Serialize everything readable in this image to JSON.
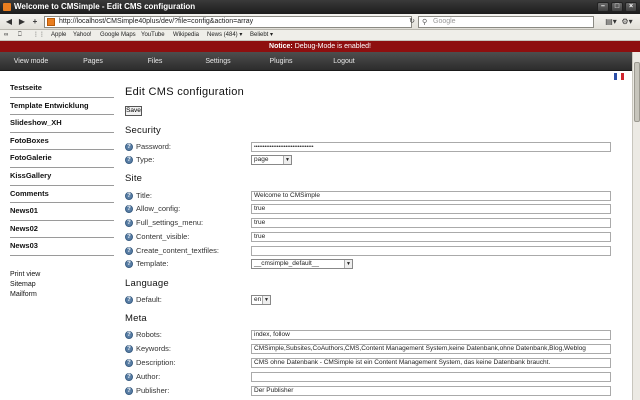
{
  "window": {
    "title": "Welcome to CMSimple - Edit CMS configuration"
  },
  "browser": {
    "url": "http://localhost/CMSimple40plus/dev/?file=config&action=array",
    "search_placeholder": "Google",
    "bookmarks": [
      "Apple",
      "Yahoo!",
      "Google Maps",
      "YouTube",
      "Wikipedia",
      "News (484) ▾",
      "Beliebt ▾"
    ]
  },
  "notice": {
    "label": "Notice:",
    "text": " Debug-Mode is enabled!"
  },
  "menu": [
    "View mode",
    "Pages",
    "Files",
    "Settings",
    "Plugins",
    "Logout"
  ],
  "sidebar": {
    "items": [
      "Testseite",
      "Template Entwicklung",
      "Slideshow_XH",
      "FotoBoxes",
      "FotoGalerie",
      "KissGallery",
      "Comments",
      "News01",
      "News02",
      "News03"
    ],
    "links": [
      "Print view",
      "Sitemap",
      "Mailform"
    ]
  },
  "page": {
    "title": "Edit CMS configuration",
    "save_label": "Save"
  },
  "sections": {
    "security": "Security",
    "site": "Site",
    "language": "Language",
    "meta": "Meta"
  },
  "fields": {
    "password": {
      "label": "Password:",
      "value": "••••••••••••••••••••••••••••••••••"
    },
    "type": {
      "label": "Type:",
      "value": "page"
    },
    "title": {
      "label": "Title:",
      "value": "Welcome to CMSimple"
    },
    "allow_config": {
      "label": "Allow_config:",
      "value": "true"
    },
    "full_settings_menu": {
      "label": "Full_settings_menu:",
      "value": "true"
    },
    "content_visible": {
      "label": "Content_visible:",
      "value": "true"
    },
    "create_content_textfiles": {
      "label": "Create_content_textfiles:",
      "value": ""
    },
    "template": {
      "label": "Template:",
      "value": "__cmsimple_default__"
    },
    "default": {
      "label": "Default:",
      "value": "en"
    },
    "robots": {
      "label": "Robots:",
      "value": "index, follow"
    },
    "keywords": {
      "label": "Keywords:",
      "value": "CMSimple,Subsites,CoAuthors,CMS,Content Management System,keine Datenbank,ohne Datenbank,Blog,Weblog"
    },
    "description": {
      "label": "Description:",
      "value": "CMS ohne Datenbank - CMSimple ist ein Content Management System, das keine Datenbank braucht."
    },
    "author": {
      "label": "Author:",
      "value": ""
    },
    "publisher": {
      "label": "Publisher:",
      "value": "Der Publisher"
    }
  },
  "colors": {
    "notice_bg": "#8e0f0f",
    "menu_bg": "#2c2c2c",
    "help_icon": "#5a7fa6"
  }
}
